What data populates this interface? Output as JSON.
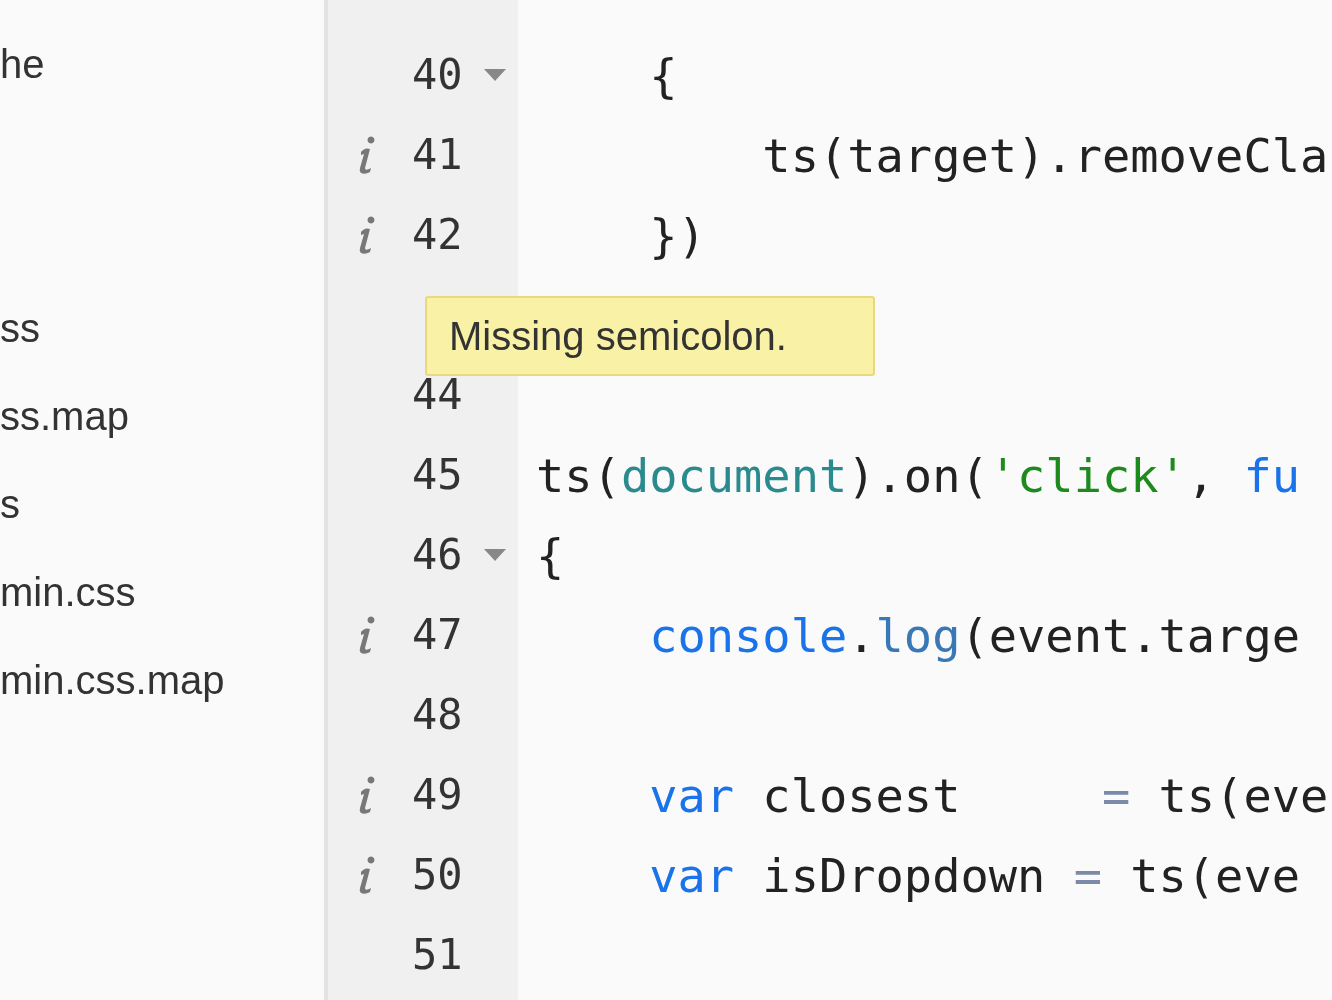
{
  "sidebar": {
    "groups": [
      [
        "he"
      ],
      [
        "ss",
        "ss.map",
        "s",
        "min.css",
        "min.css.map"
      ]
    ]
  },
  "editor": {
    "lines": [
      {
        "kind": "code",
        "number": "40",
        "info": false,
        "foldable": true,
        "tokens": [
          {
            "kind": "plain",
            "text": "    {"
          }
        ]
      },
      {
        "kind": "code",
        "number": "41",
        "info": true,
        "foldable": false,
        "tokens": [
          {
            "kind": "plain",
            "text": "        ts(target).removeCla"
          }
        ]
      },
      {
        "kind": "code",
        "number": "42",
        "info": true,
        "foldable": false,
        "tokens": [
          {
            "kind": "plain",
            "text": "    })"
          }
        ]
      },
      {
        "kind": "covered"
      },
      {
        "kind": "code",
        "number": "44",
        "info": false,
        "foldable": false
      },
      {
        "kind": "code",
        "number": "45",
        "info": false,
        "foldable": false,
        "tokens": [
          {
            "kind": "plain",
            "text": "ts("
          },
          {
            "kind": "builtin",
            "text": "document"
          },
          {
            "kind": "plain",
            "text": ").on("
          },
          {
            "kind": "string",
            "text": "'click'"
          },
          {
            "kind": "plain",
            "text": ", "
          },
          {
            "kind": "keyword",
            "text": "fu"
          }
        ]
      },
      {
        "kind": "code",
        "number": "46",
        "info": false,
        "foldable": true,
        "tokens": [
          {
            "kind": "plain",
            "text": "{"
          }
        ]
      },
      {
        "kind": "code",
        "number": "47",
        "info": true,
        "foldable": false,
        "tokens": [
          {
            "kind": "keyword",
            "text": "    console"
          },
          {
            "kind": "plain",
            "text": "."
          },
          {
            "kind": "method",
            "text": "log"
          },
          {
            "kind": "plain",
            "text": "(event.targe"
          }
        ]
      },
      {
        "kind": "code",
        "number": "48",
        "info": false,
        "foldable": false
      },
      {
        "kind": "code",
        "number": "49",
        "info": true,
        "foldable": false,
        "tokens": [
          {
            "kind": "keyword",
            "text": "    var"
          },
          {
            "kind": "plain",
            "text": " closest     "
          },
          {
            "kind": "operator",
            "text": "="
          },
          {
            "kind": "plain",
            "text": " ts(eve"
          }
        ]
      },
      {
        "kind": "code",
        "number": "50",
        "info": true,
        "foldable": false,
        "tokens": [
          {
            "kind": "keyword",
            "text": "    var"
          },
          {
            "kind": "plain",
            "text": " isDropdown "
          },
          {
            "kind": "operator",
            "text": "="
          },
          {
            "kind": "plain",
            "text": " ts(eve"
          }
        ]
      },
      {
        "kind": "code",
        "number": "51",
        "info": false,
        "foldable": false
      }
    ]
  },
  "tooltip": {
    "text": "Missing semicolon."
  }
}
